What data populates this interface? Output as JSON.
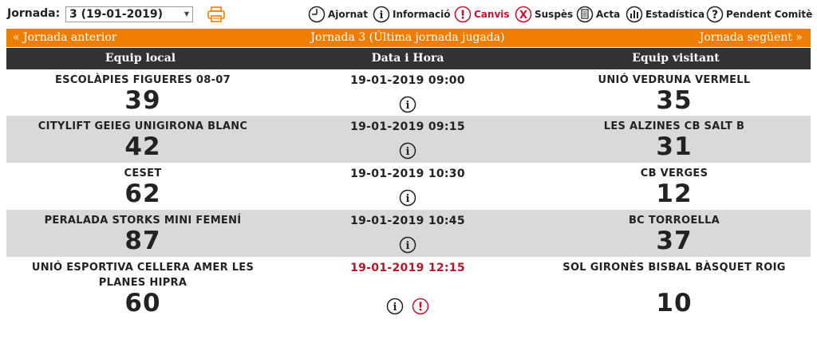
{
  "jornada": {
    "label": "Jornada:",
    "selected": "3 (19-01-2019)"
  },
  "legend": [
    {
      "icon": "clock-icon",
      "label": "Ajornat",
      "color": "#222222"
    },
    {
      "icon": "info-icon",
      "label": "Informació",
      "color": "#222222"
    },
    {
      "icon": "exclamation-icon",
      "label": "Canvis",
      "color": "#c8102e"
    },
    {
      "icon": "x-circle-icon",
      "label": "Suspès",
      "color": "#222222"
    },
    {
      "icon": "document-icon",
      "label": "Acta",
      "color": "#222222"
    },
    {
      "icon": "stats-icon",
      "label": "Estadística",
      "color": "#222222"
    },
    {
      "icon": "question-icon",
      "label": "Pendent Comitè",
      "color": "#222222"
    }
  ],
  "nav": {
    "prev": "«  Jornada anterior",
    "current": "Jornada 3 (Última jornada jugada)",
    "next": "Jornada següent  »"
  },
  "headers": {
    "local": "Equip local",
    "date": "Data i Hora",
    "visitor": "Equip visitant"
  },
  "colors": {
    "orange": "#ef7d00",
    "dark": "#333333",
    "grey_row": "#d9d9d9",
    "red": "#b0182b"
  },
  "matches": [
    {
      "local": "ESCOLÀPIES FIGUERES 08-07",
      "local_score": "39",
      "datetime": "19-01-2019 09:00",
      "visitor": "UNIÓ VEDRUNA VERMELL",
      "visitor_score": "35"
    },
    {
      "local": "CITYLIFT GEIEG UNIGIRONA BLANC",
      "local_score": "42",
      "datetime": "19-01-2019 09:15",
      "visitor": "LES ALZINES CB SALT B",
      "visitor_score": "31"
    },
    {
      "local": "CESET",
      "local_score": "62",
      "datetime": "19-01-2019 10:30",
      "visitor": "CB VERGES",
      "visitor_score": "12"
    },
    {
      "local": "PERALADA STORKS MINI FEMENÍ",
      "local_score": "87",
      "datetime": "19-01-2019 10:45",
      "visitor": "BC TORROELLA",
      "visitor_score": "37"
    },
    {
      "local_line1": "UNIÓ ESPORTIVA CELLERA AMER LES",
      "local_line2": "PLANES HIPRA",
      "local_score": "60",
      "datetime": "19-01-2019 12:15",
      "visitor": "SOL GIRONÈS BISBAL BÀSQUET ROIG",
      "visitor_score": "10"
    }
  ]
}
